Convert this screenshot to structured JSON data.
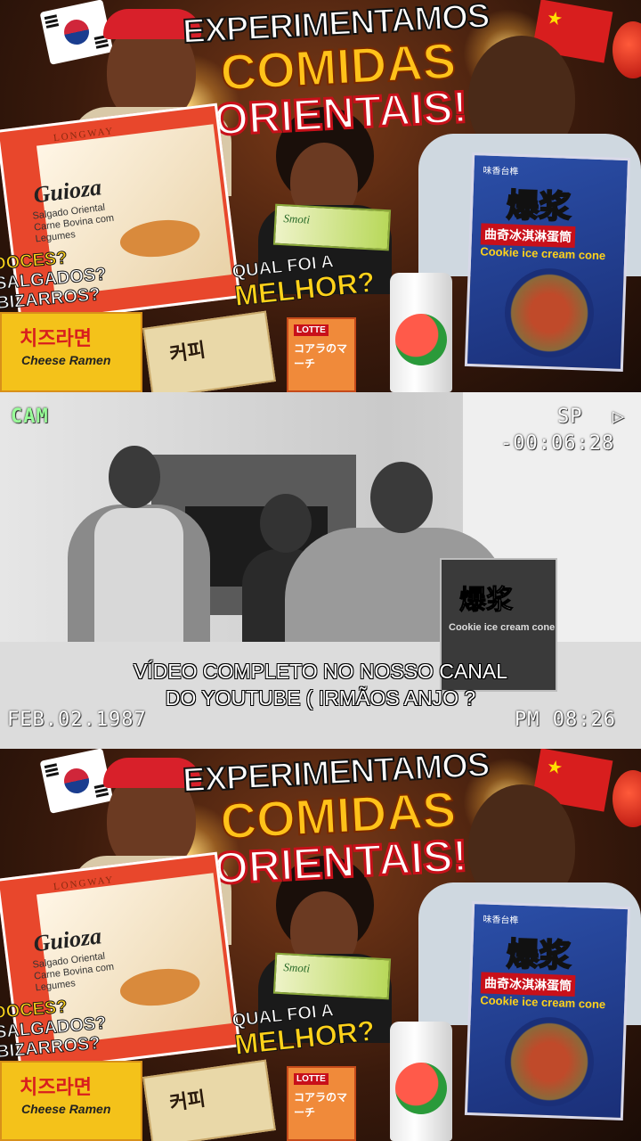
{
  "thumbnail": {
    "title_line1": "EXPERIMENTAMOS",
    "title_line2": "COMIDAS",
    "title_line3": "ORIENTAIS!",
    "question_line1": "QUAL FOI A",
    "question_line2": "MELHOR?",
    "side_questions": [
      "DOCES?",
      "SALGADOS?",
      "BIZARROS?"
    ],
    "gyoza_brand": "LONGWAY",
    "gyoza_name": "Guioza",
    "gyoza_sub": "Salgado Oriental Carne Bovina com Legumes",
    "ramen_korean": "치즈라면",
    "ramen_english": "Cheese Ramen",
    "coffee_korean": "커피",
    "koala_lotte": "LOTTE",
    "koala_japanese": "コアラのマーチ",
    "smoti_label": "Smoti",
    "cn_pack_small": "味香台榫",
    "cn_pack_big": "爆浆",
    "cn_pack_red": "曲奇冰淇淋蛋筒",
    "cn_pack_english": "Cookie ice cream cone"
  },
  "camcorder": {
    "cam_label": "CAM",
    "sp_label": "SP",
    "play_icon": "▷",
    "timecode": "-00:06:28",
    "date": "FEB.02.1987",
    "time": "PM 08:26",
    "pack_big": "爆浆",
    "pack_english": "Cookie ice cream cone"
  },
  "caption": {
    "line1": "VÍDEO COMPLETO NO NOSSO CANAL",
    "line2": "DO YOUTUBE ( IRMÃOS ANJO ?"
  }
}
